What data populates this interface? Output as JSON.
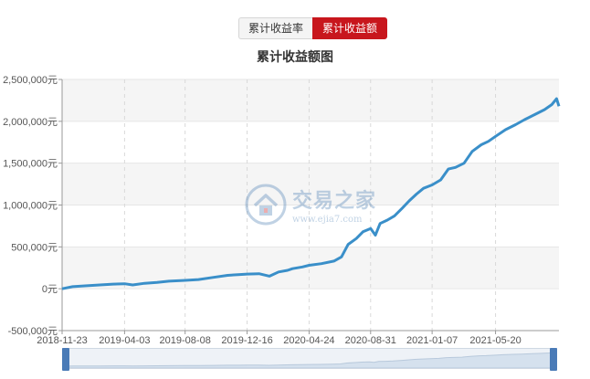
{
  "tabs": [
    {
      "label": "累计收益率",
      "active": false
    },
    {
      "label": "累计收益额",
      "active": true
    }
  ],
  "watermark": {
    "name": "交易之家",
    "url": "www.ejia7.com"
  },
  "colors": {
    "line": "#3a8fc9",
    "accent": "#c8161d",
    "band": "#f5f5f5",
    "grid": "#e6e6e6"
  },
  "chart_data": {
    "type": "line",
    "title": "累计收益额图",
    "y_unit": "元",
    "ylim": [
      -500000,
      2500000
    ],
    "y_ticks": [
      -500000,
      0,
      500000,
      1000000,
      1500000,
      2000000,
      2500000
    ],
    "y_tick_labels": [
      "-500,000元",
      "0元",
      "500,000元",
      "1,000,000元",
      "1,500,000元",
      "2,000,000元",
      "2,500,000元"
    ],
    "xlim": [
      "2018-11-23",
      "2021-09-30"
    ],
    "x_ticks": [
      "2018-11-23",
      "2019-04-03",
      "2019-08-08",
      "2019-12-16",
      "2020-04-24",
      "2020-08-31",
      "2021-01-07",
      "2021-05-20"
    ],
    "grid": "vertical dashed, horizontal bands",
    "series": [
      {
        "x": [
          "2018-11-23",
          "2018-12-15",
          "2019-01-10",
          "2019-02-10",
          "2019-03-10",
          "2019-04-03",
          "2019-04-20",
          "2019-05-15",
          "2019-06-10",
          "2019-07-05",
          "2019-08-08",
          "2019-09-05",
          "2019-10-05",
          "2019-11-05",
          "2019-12-01",
          "2019-12-16",
          "2020-01-10",
          "2020-02-01",
          "2020-02-20",
          "2020-03-10",
          "2020-03-20",
          "2020-04-10",
          "2020-04-24",
          "2020-05-20",
          "2020-06-15",
          "2020-07-01",
          "2020-07-15",
          "2020-08-01",
          "2020-08-15",
          "2020-08-31",
          "2020-09-10",
          "2020-09-20",
          "2020-10-05",
          "2020-10-20",
          "2020-11-05",
          "2020-11-20",
          "2020-12-05",
          "2020-12-20",
          "2021-01-07",
          "2021-01-25",
          "2021-02-10",
          "2021-02-25",
          "2021-03-15",
          "2021-04-01",
          "2021-04-20",
          "2021-05-05",
          "2021-05-20",
          "2021-06-10",
          "2021-07-01",
          "2021-07-20",
          "2021-08-10",
          "2021-08-31",
          "2021-09-15",
          "2021-09-25",
          "2021-09-30"
        ],
        "values": [
          0,
          25000,
          35000,
          45000,
          55000,
          60000,
          45000,
          65000,
          75000,
          90000,
          100000,
          110000,
          135000,
          160000,
          170000,
          175000,
          180000,
          150000,
          200000,
          220000,
          240000,
          260000,
          280000,
          300000,
          330000,
          380000,
          530000,
          600000,
          680000,
          720000,
          640000,
          780000,
          820000,
          870000,
          960000,
          1050000,
          1130000,
          1200000,
          1240000,
          1300000,
          1430000,
          1450000,
          1500000,
          1640000,
          1720000,
          1760000,
          1820000,
          1900000,
          1960000,
          2020000,
          2080000,
          2140000,
          2200000,
          2270000,
          2180000
        ]
      }
    ]
  }
}
